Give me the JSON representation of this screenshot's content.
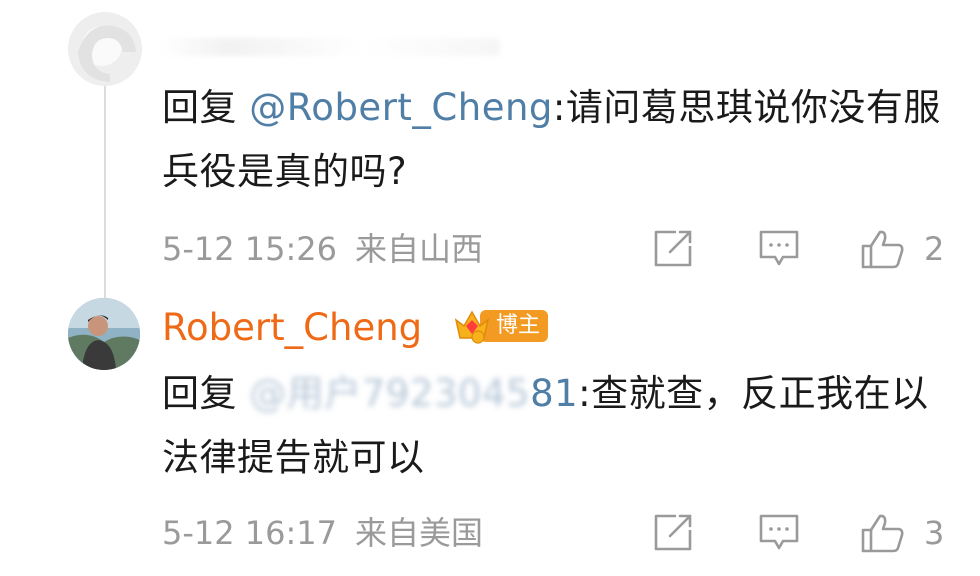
{
  "comments": [
    {
      "reply_prefix": "回复",
      "mention": "@Robert_Cheng",
      "text": ":请问葛思琪说你没有服兵役是真的吗?",
      "time": "5-12 15:26",
      "location": "来自山西",
      "likes": "2"
    },
    {
      "username": "Robert_Cheng",
      "badge": "博主",
      "reply_prefix": "回复",
      "mention_partial": "@用户7923045",
      "mention_visible_end": "81",
      "text": ":查就查，反正我在以法律提告就可以",
      "time": "5-12 16:17",
      "location": "来自美国",
      "likes": "3"
    }
  ],
  "icons": {
    "share": "share-edit-icon",
    "comment": "comment-bubble-icon",
    "like": "thumbs-up-icon",
    "badge": "crown-gem-icon"
  },
  "colors": {
    "username": "#ef6a17",
    "mention": "#4f7ea6",
    "meta": "#9a9a9a",
    "badge": "#f39a22"
  }
}
